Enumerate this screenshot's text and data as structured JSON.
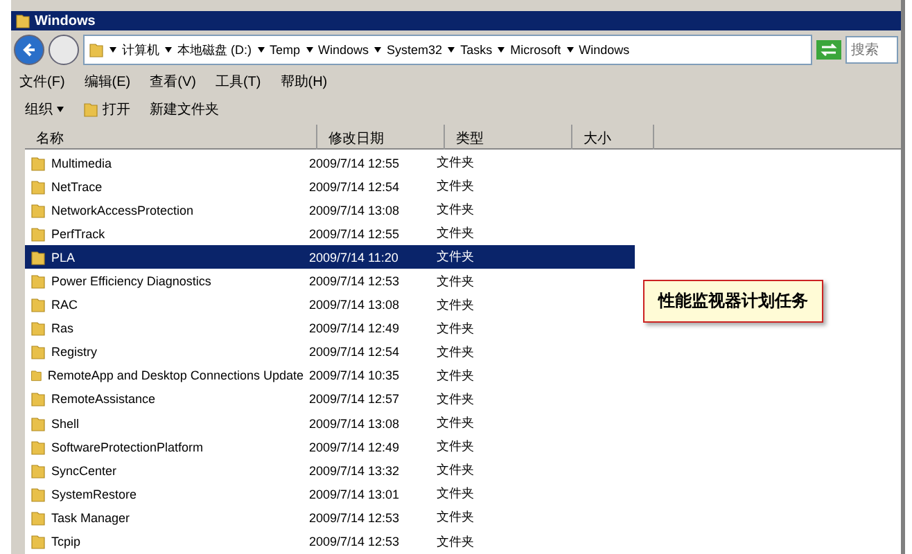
{
  "window": {
    "title": "Windows"
  },
  "address": {
    "segments": [
      "计算机",
      "本地磁盘 (D:)",
      "Temp",
      "Windows",
      "System32",
      "Tasks",
      "Microsoft",
      "Windows"
    ]
  },
  "search": {
    "placeholder": "搜索"
  },
  "menu": [
    "文件(F)",
    "编辑(E)",
    "查看(V)",
    "工具(T)",
    "帮助(H)"
  ],
  "toolbar": {
    "organize": "组织",
    "open": "打开",
    "new_folder": "新建文件夹"
  },
  "columns": [
    "名称",
    "修改日期",
    "类型",
    "大小"
  ],
  "rows": [
    {
      "name": "Multimedia",
      "date": "2009/7/14 12:55",
      "type": "文件夹",
      "selected": false
    },
    {
      "name": "NetTrace",
      "date": "2009/7/14 12:54",
      "type": "文件夹",
      "selected": false
    },
    {
      "name": "NetworkAccessProtection",
      "date": "2009/7/14 13:08",
      "type": "文件夹",
      "selected": false
    },
    {
      "name": "PerfTrack",
      "date": "2009/7/14 12:55",
      "type": "文件夹",
      "selected": false
    },
    {
      "name": "PLA",
      "date": "2009/7/14 11:20",
      "type": "文件夹",
      "selected": true
    },
    {
      "name": "Power Efficiency Diagnostics",
      "date": "2009/7/14 12:53",
      "type": "文件夹",
      "selected": false
    },
    {
      "name": "RAC",
      "date": "2009/7/14 13:08",
      "type": "文件夹",
      "selected": false
    },
    {
      "name": "Ras",
      "date": "2009/7/14 12:49",
      "type": "文件夹",
      "selected": false
    },
    {
      "name": "Registry",
      "date": "2009/7/14 12:54",
      "type": "文件夹",
      "selected": false
    },
    {
      "name": "RemoteApp and Desktop Connections Update",
      "date": "2009/7/14 10:35",
      "type": "文件夹",
      "selected": false
    },
    {
      "name": "RemoteAssistance",
      "date": "2009/7/14 12:57",
      "type": "文件夹",
      "selected": false
    },
    {
      "name": "Shell",
      "date": "2009/7/14 13:08",
      "type": "文件夹",
      "selected": false
    },
    {
      "name": "SoftwareProtectionPlatform",
      "date": "2009/7/14 12:49",
      "type": "文件夹",
      "selected": false
    },
    {
      "name": "SyncCenter",
      "date": "2009/7/14 13:32",
      "type": "文件夹",
      "selected": false
    },
    {
      "name": "SystemRestore",
      "date": "2009/7/14 13:01",
      "type": "文件夹",
      "selected": false
    },
    {
      "name": "Task Manager",
      "date": "2009/7/14 12:53",
      "type": "文件夹",
      "selected": false
    },
    {
      "name": "Tcpip",
      "date": "2009/7/14 12:53",
      "type": "文件夹",
      "selected": false
    }
  ],
  "callout": {
    "text": "性能监视器计划任务"
  }
}
